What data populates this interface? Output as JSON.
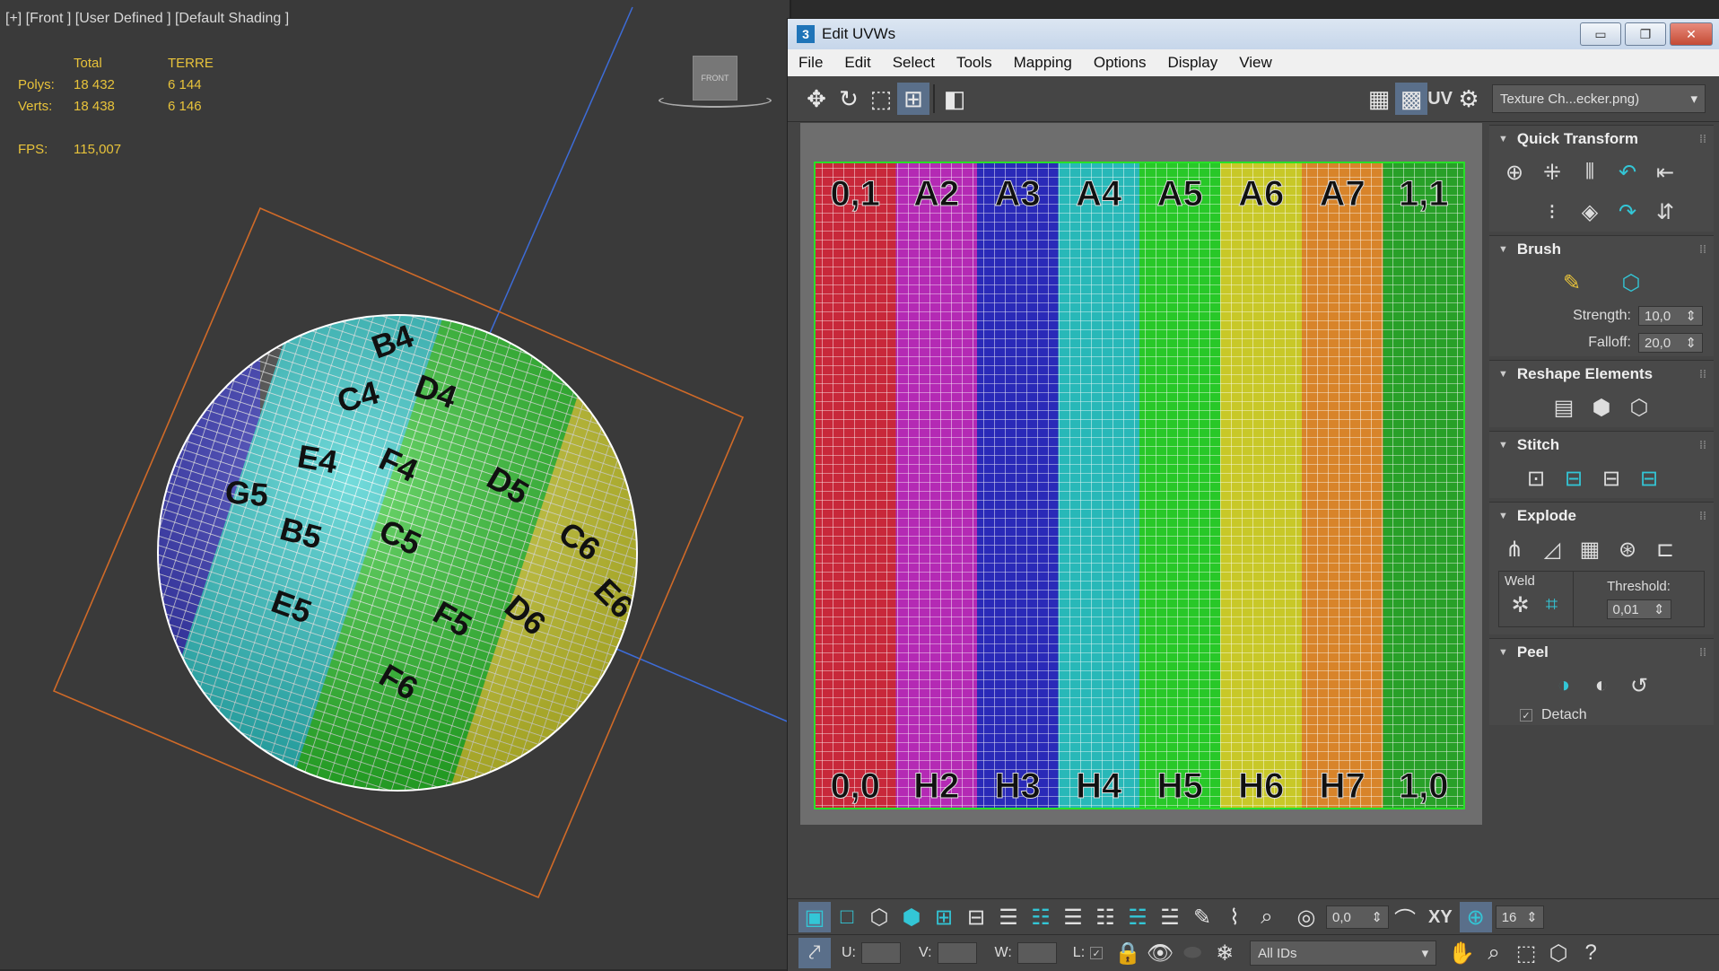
{
  "viewport": {
    "label": "[+] [Front ] [User Defined ] [Default Shading ]",
    "stats": {
      "header_total": "Total",
      "header_object": "TERRE",
      "polys_label": "Polys:",
      "polys_total": "18 432",
      "polys_object": "6 144",
      "verts_label": "Verts:",
      "verts_total": "18 438",
      "verts_object": "6 146",
      "fps_label": "FPS:",
      "fps_value": "115,007"
    },
    "navcube_label": "FRONT",
    "sphere_labels": [
      "B4",
      "C4",
      "D4",
      "E4",
      "F4",
      "B5",
      "C5",
      "D5",
      "E5",
      "F5",
      "C6",
      "D6",
      "E6",
      "F6",
      "G5"
    ]
  },
  "window": {
    "title": "Edit UVWs",
    "app_icon": "3",
    "buttons": {
      "minimize": "▭",
      "maximize": "❐",
      "close": "✕"
    }
  },
  "menu": [
    "File",
    "Edit",
    "Select",
    "Tools",
    "Mapping",
    "Options",
    "Display",
    "View"
  ],
  "toolbar": {
    "uv_label": "UV",
    "texture_select": "Texture Ch...ecker.png)"
  },
  "uv_grid": {
    "column_colors": [
      "#c8283a",
      "#b42ab4",
      "#2a2ab8",
      "#28b8b8",
      "#28c828",
      "#c8c828",
      "#d8842a",
      "#28a028"
    ],
    "top_labels": [
      "0,1",
      "A2",
      "A3",
      "A4",
      "A5",
      "A6",
      "A7",
      "1,1"
    ],
    "bottom_labels": [
      "0,0",
      "H2",
      "H3",
      "H4",
      "H5",
      "H6",
      "H7",
      "1,0"
    ]
  },
  "panel": {
    "quick_transform": "Quick Transform",
    "brush": "Brush",
    "strength_label": "Strength:",
    "strength_value": "10,0",
    "falloff_label": "Falloff:",
    "falloff_value": "20,0",
    "reshape": "Reshape Elements",
    "stitch": "Stitch",
    "explode": "Explode",
    "weld": "Weld",
    "threshold_label": "Threshold:",
    "threshold_value": "0,01",
    "peel": "Peel",
    "detach_label": "Detach"
  },
  "bottom": {
    "angle_value": "0,0",
    "xy_label": "XY",
    "snap_value": "16",
    "u_label": "U:",
    "v_label": "V:",
    "w_label": "W:",
    "l_label": "L:",
    "ids_select": "All IDs"
  }
}
